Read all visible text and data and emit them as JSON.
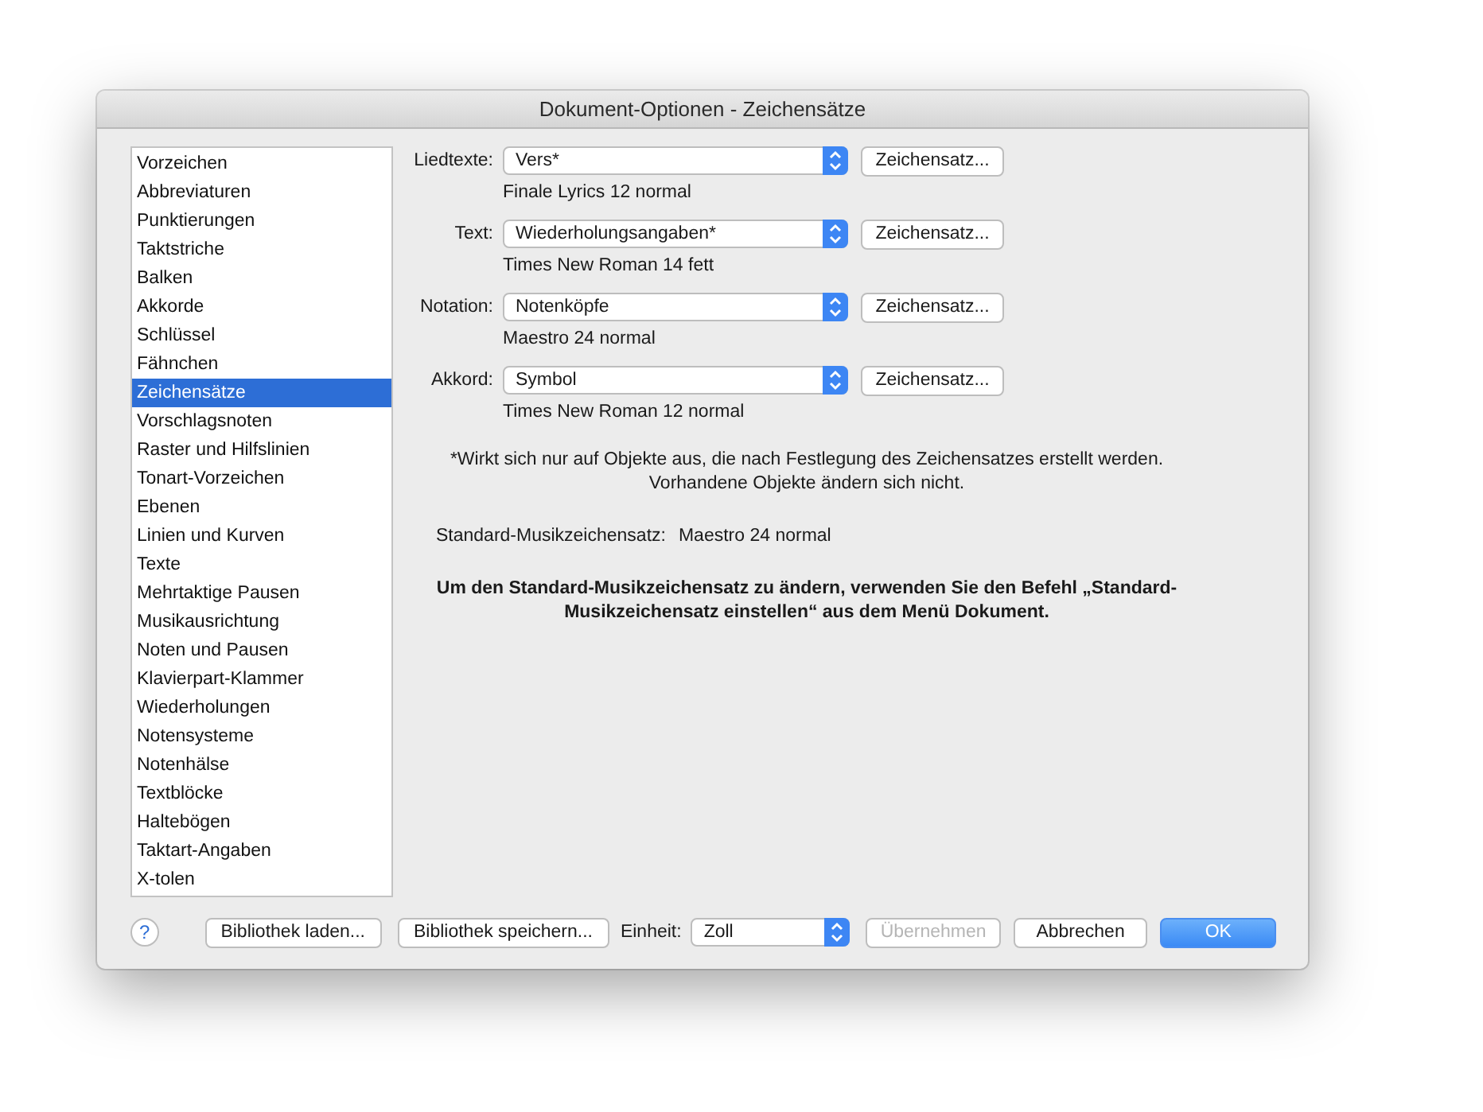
{
  "window": {
    "title": "Dokument-Optionen - Zeichensätze"
  },
  "sidebar": {
    "items": [
      {
        "label": "Vorzeichen",
        "selected": false
      },
      {
        "label": "Abbreviaturen",
        "selected": false
      },
      {
        "label": "Punktierungen",
        "selected": false
      },
      {
        "label": "Taktstriche",
        "selected": false
      },
      {
        "label": "Balken",
        "selected": false
      },
      {
        "label": "Akkorde",
        "selected": false
      },
      {
        "label": "Schlüssel",
        "selected": false
      },
      {
        "label": "Fähnchen",
        "selected": false
      },
      {
        "label": "Zeichensätze",
        "selected": true
      },
      {
        "label": "Vorschlagsnoten",
        "selected": false
      },
      {
        "label": "Raster und Hilfslinien",
        "selected": false
      },
      {
        "label": "Tonart-Vorzeichen",
        "selected": false
      },
      {
        "label": "Ebenen",
        "selected": false
      },
      {
        "label": "Linien und Kurven",
        "selected": false
      },
      {
        "label": "Texte",
        "selected": false
      },
      {
        "label": "Mehrtaktige Pausen",
        "selected": false
      },
      {
        "label": "Musikausrichtung",
        "selected": false
      },
      {
        "label": "Noten und Pausen",
        "selected": false
      },
      {
        "label": "Klavierpart-Klammer",
        "selected": false
      },
      {
        "label": "Wiederholungen",
        "selected": false
      },
      {
        "label": "Notensysteme",
        "selected": false
      },
      {
        "label": "Notenhälse",
        "selected": false
      },
      {
        "label": "Textblöcke",
        "selected": false
      },
      {
        "label": "Haltebögen",
        "selected": false
      },
      {
        "label": "Taktart-Angaben",
        "selected": false
      },
      {
        "label": "X-tolen",
        "selected": false
      }
    ]
  },
  "font_rows": [
    {
      "label": "Liedtexte:",
      "value": "Vers*",
      "description": "Finale Lyrics 12 normal",
      "button": "Zeichensatz..."
    },
    {
      "label": "Text:",
      "value": "Wiederholungsangaben*",
      "description": "Times New Roman 14 fett",
      "button": "Zeichensatz..."
    },
    {
      "label": "Notation:",
      "value": "Notenköpfe",
      "description": "Maestro 24 normal",
      "button": "Zeichensatz..."
    },
    {
      "label": "Akkord:",
      "value": "Symbol",
      "description": "Times New Roman 12 normal",
      "button": "Zeichensatz..."
    }
  ],
  "note_lines": [
    "*Wirkt sich nur auf Objekte aus, die nach Festlegung des Zeichensatzes erstellt werden.",
    "Vorhandene Objekte ändern sich nicht."
  ],
  "standard_font": {
    "label": "Standard-Musikzeichensatz:",
    "value": "Maestro 24 normal"
  },
  "instruction_lines": [
    "Um den Standard-Musikzeichensatz zu ändern, verwenden Sie den Befehl „Standard-",
    "Musikzeichensatz einstellen“ aus dem Menü Dokument."
  ],
  "footer": {
    "help": "?",
    "library_buttons": [
      "Bibliothek laden...",
      "Bibliothek speichern..."
    ],
    "unit": {
      "label": "Einheit:",
      "value": "Zoll"
    },
    "buttons": [
      {
        "label": "Übernehmen",
        "disabled": true,
        "default": false
      },
      {
        "label": "Abbrechen",
        "disabled": false,
        "default": false
      },
      {
        "label": "OK",
        "disabled": false,
        "default": true
      }
    ]
  }
}
